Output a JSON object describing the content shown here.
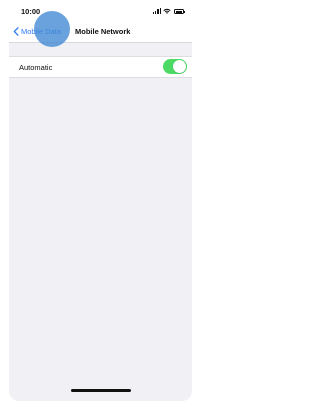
{
  "status_bar": {
    "time": "10:00",
    "icons": [
      "signal-icon",
      "wifi-icon",
      "battery-icon"
    ]
  },
  "nav_bar": {
    "back_label": "Mobile Data",
    "back_icon": "chevron-left-icon",
    "title": "Mobile Network"
  },
  "settings": {
    "rows": [
      {
        "label": "Automatic",
        "toggle_on": true
      }
    ]
  },
  "colors": {
    "accent": "#2f7cf6",
    "toggle_on": "#4cd964",
    "background": "#f1f1f5",
    "touch_indicator": "#4088d3"
  }
}
